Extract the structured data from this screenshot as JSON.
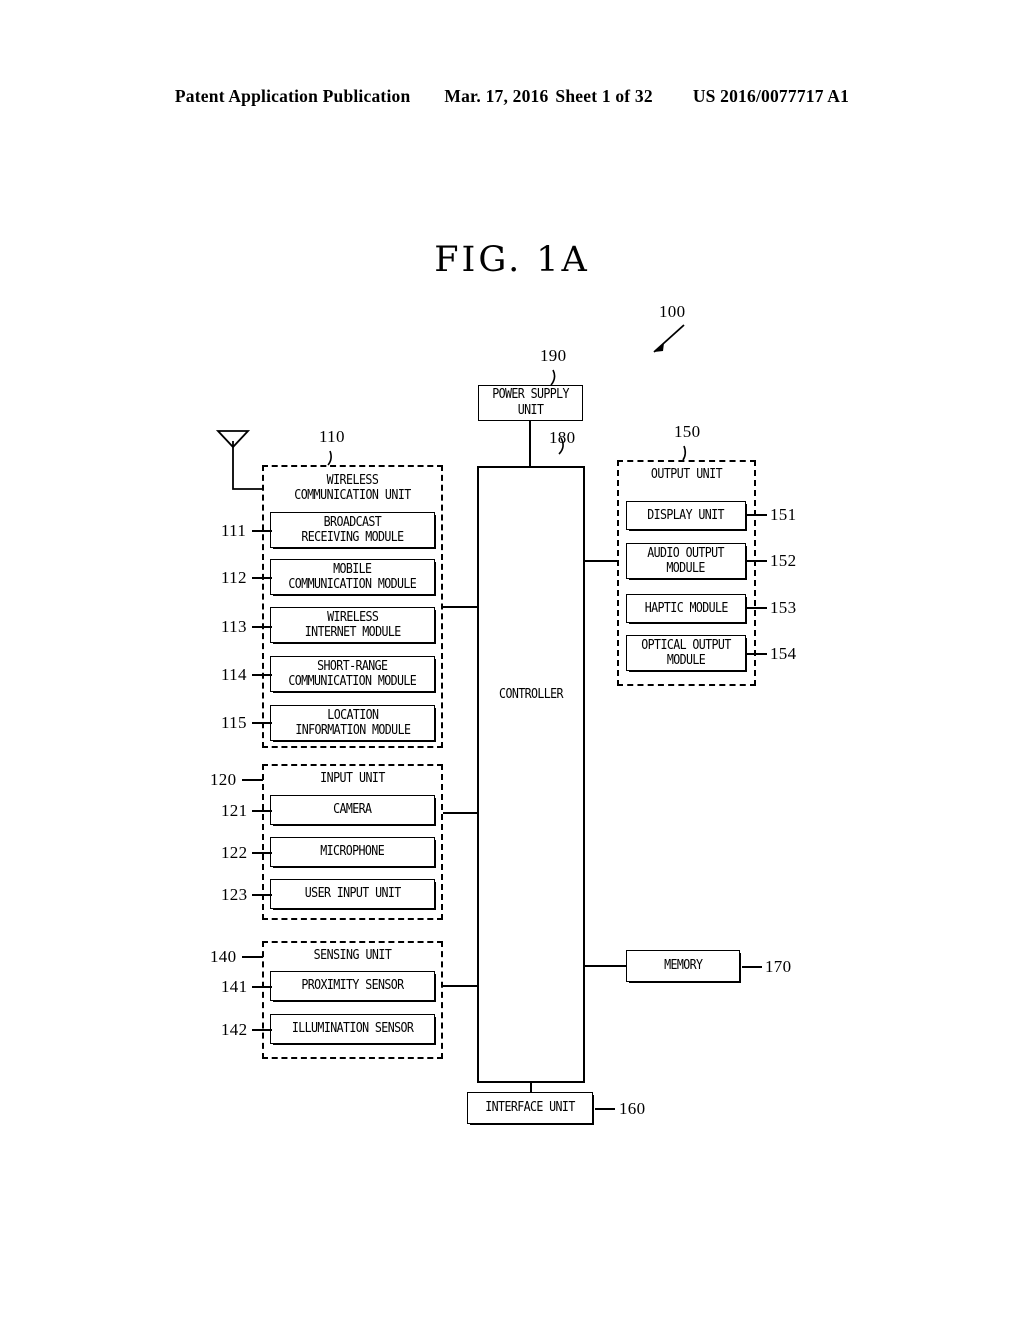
{
  "header": {
    "publication": "Patent Application Publication",
    "date": "Mar. 17, 2016",
    "sheet": "Sheet 1 of 32",
    "patent_number": "US 2016/0077717 A1"
  },
  "figure": {
    "title_prefix": "FIG.",
    "title_suffix": "1A",
    "system_ref": "100"
  },
  "power_supply": {
    "ref": "190",
    "line1": "POWER SUPPLY",
    "line2": "UNIT"
  },
  "controller": {
    "ref": "180",
    "label": "CONTROLLER"
  },
  "wireless": {
    "ref": "110",
    "title_line1": "WIRELESS",
    "title_line2": "COMMUNICATION UNIT",
    "modules": [
      {
        "ref": "111",
        "line1": "BROADCAST",
        "line2": "RECEIVING MODULE"
      },
      {
        "ref": "112",
        "line1": "MOBILE",
        "line2": "COMMUNICATION MODULE"
      },
      {
        "ref": "113",
        "line1": "WIRELESS",
        "line2": "INTERNET MODULE"
      },
      {
        "ref": "114",
        "line1": "SHORT-RANGE",
        "line2": "COMMUNICATION MODULE"
      },
      {
        "ref": "115",
        "line1": "LOCATION",
        "line2": "INFORMATION MODULE"
      }
    ]
  },
  "input_unit": {
    "ref": "120",
    "title": "INPUT UNIT",
    "modules": [
      {
        "ref": "121",
        "line1": "CAMERA"
      },
      {
        "ref": "122",
        "line1": "MICROPHONE"
      },
      {
        "ref": "123",
        "line1": "USER INPUT UNIT"
      }
    ]
  },
  "sensing_unit": {
    "ref": "140",
    "title": "SENSING UNIT",
    "modules": [
      {
        "ref": "141",
        "line1": "PROXIMITY SENSOR"
      },
      {
        "ref": "142",
        "line1": "ILLUMINATION SENSOR"
      }
    ]
  },
  "output_unit": {
    "ref": "150",
    "title": "OUTPUT UNIT",
    "modules": [
      {
        "ref": "151",
        "line1": "DISPLAY UNIT"
      },
      {
        "ref": "152",
        "line1": "AUDIO OUTPUT",
        "line2": "MODULE"
      },
      {
        "ref": "153",
        "line1": "HAPTIC MODULE"
      },
      {
        "ref": "154",
        "line1": "OPTICAL OUTPUT",
        "line2": "MODULE"
      }
    ]
  },
  "memory": {
    "ref": "170",
    "label": "MEMORY"
  },
  "interface": {
    "ref": "160",
    "label": "INTERFACE UNIT"
  },
  "colors": {
    "ink": "#000000",
    "paper": "#ffffff"
  }
}
